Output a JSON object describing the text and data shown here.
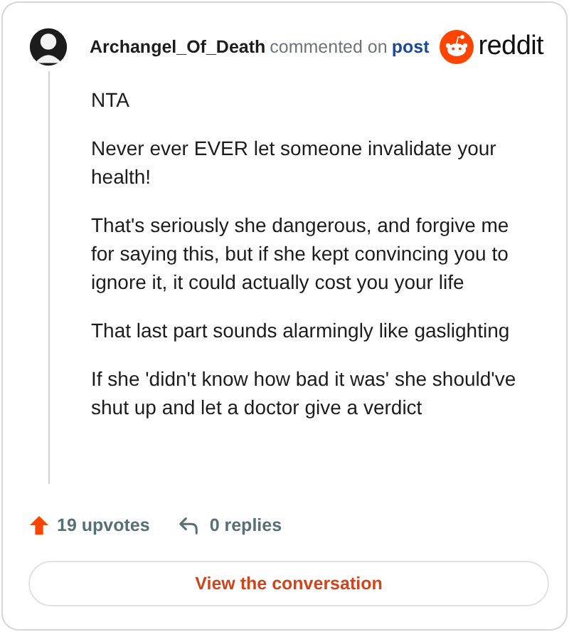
{
  "header": {
    "author": "Archangel_Of_Death",
    "action": "commented on",
    "link": "post",
    "brand": "reddit"
  },
  "comment": {
    "paragraphs": [
      "NTA",
      "Never ever EVER let someone invalidate your health!",
      "That's seriously she dangerous, and forgive me for saying this, but if she kept convincing you to ignore it, it could actually cost you your life",
      "That last part sounds alarmingly like gaslighting",
      "If she 'didn't know how bad it was' she should've shut up and let a doctor give a verdict"
    ]
  },
  "stats": {
    "upvotes": "19 upvotes",
    "replies": "0 replies"
  },
  "button": "View the conversation"
}
